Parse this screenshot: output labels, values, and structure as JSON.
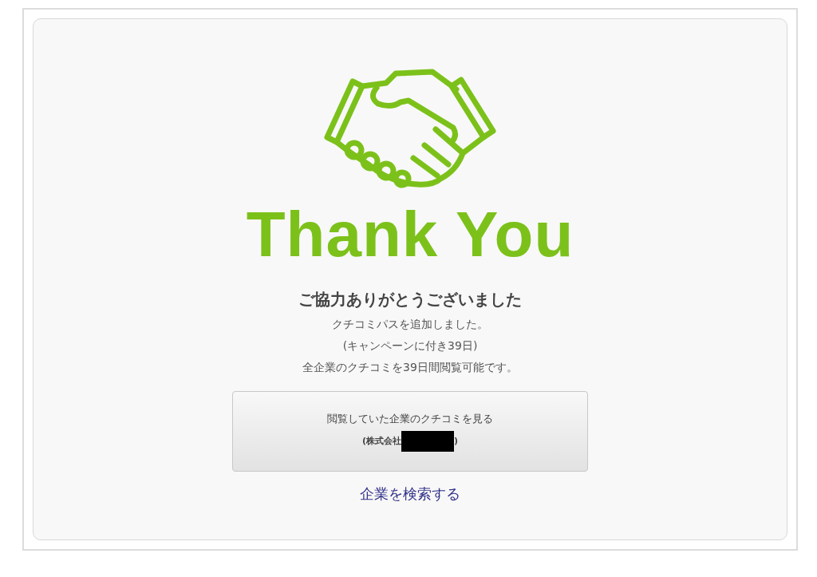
{
  "hero": {
    "title": "Thank You"
  },
  "message": {
    "heading": "ご協力ありがとうございました",
    "lines": [
      "クチコミパスを追加しました。",
      "(キャンペーンに付き39日)",
      "全企業のクチコミを39日間閲覧可能です。"
    ]
  },
  "action_button": {
    "label": "閲覧していた企業のクチコミを見る",
    "sub_label_start": "(株式会社",
    "sub_label_end": ")",
    "redacted": true
  },
  "link": {
    "label": "企業を検索する"
  }
}
